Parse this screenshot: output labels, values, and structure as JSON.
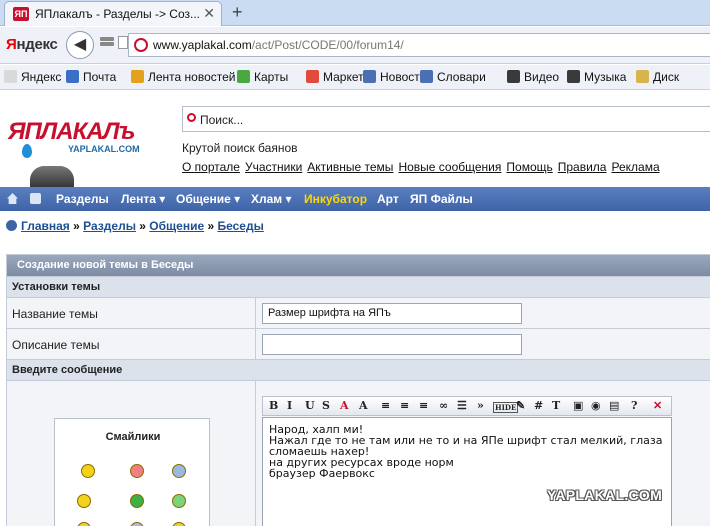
{
  "browser": {
    "tab_title": "ЯПлакалъ - Разделы -> Соз...",
    "tab_close": "✕",
    "new_tab": "+",
    "logo": "Яндекс",
    "url_domain": "www.yaplakal.com",
    "url_path": "/act/Post/CODE/00/forum14/",
    "bookmarks": [
      "Яндекс",
      "Почта",
      "Лента новостей",
      "Карты",
      "Маркет",
      "Новости",
      "Словари",
      "Видео",
      "Музыка",
      "Диск"
    ],
    "bookmark_colors": [
      "#d9d9d9",
      "#3b6fc4",
      "#e3a21a",
      "#49a83f",
      "#e14b3b",
      "#4a6fb3",
      "#4a6fb3",
      "#3a3a3a",
      "#3a3a3a",
      "#d7b54a"
    ]
  },
  "site": {
    "logo_text": "ЯПЛАКАЛъ",
    "logo_sub": "YAPLAKAL.COM",
    "search_placeholder": "Поиск...",
    "tagline": "Крутой поиск баянов",
    "top_links": [
      "О портале",
      "Участники",
      "Активные темы",
      "Новые сообщения",
      "Помощь",
      "Правила",
      "Реклама"
    ],
    "menu": [
      {
        "label": "Разделы",
        "hot": false
      },
      {
        "label": "Лента ▾",
        "hot": false
      },
      {
        "label": "Общение ▾",
        "hot": false
      },
      {
        "label": "Хлам ▾",
        "hot": false
      },
      {
        "label": "Инкубатор",
        "hot": true
      },
      {
        "label": "Арт",
        "hot": false
      },
      {
        "label": "ЯП Файлы",
        "hot": false
      }
    ],
    "breadcrumbs": [
      "Главная",
      "Разделы",
      "Общение",
      "Беседы"
    ],
    "breadcrumb_sep": " » "
  },
  "form": {
    "header": "Создание новой темы в Беседы",
    "settings_title": "Установки темы",
    "title_label": "Название темы",
    "title_value": "Размер шрифта на ЯПъ",
    "desc_label": "Описание темы",
    "desc_value": "",
    "message_title": "Введите сообщение",
    "smileys_title": "Смайлики",
    "toolbar": [
      "B",
      "I",
      "U",
      "S",
      "A",
      "A",
      "≡",
      "≡",
      "≡",
      "∞",
      "☰",
      "»",
      "HIDE",
      "✎",
      "#",
      "T",
      "▣",
      "◉",
      "▤",
      "?",
      "✕"
    ],
    "message": "Народ, халп ми!\nНажал где то не там или не то и на ЯПе шрифт стал мелкий, глаза сломаешь нахер!\nна других ресурсах вроде норм\nбраузер Фаервокс"
  },
  "watermark": "YAPLAKAL.COM"
}
